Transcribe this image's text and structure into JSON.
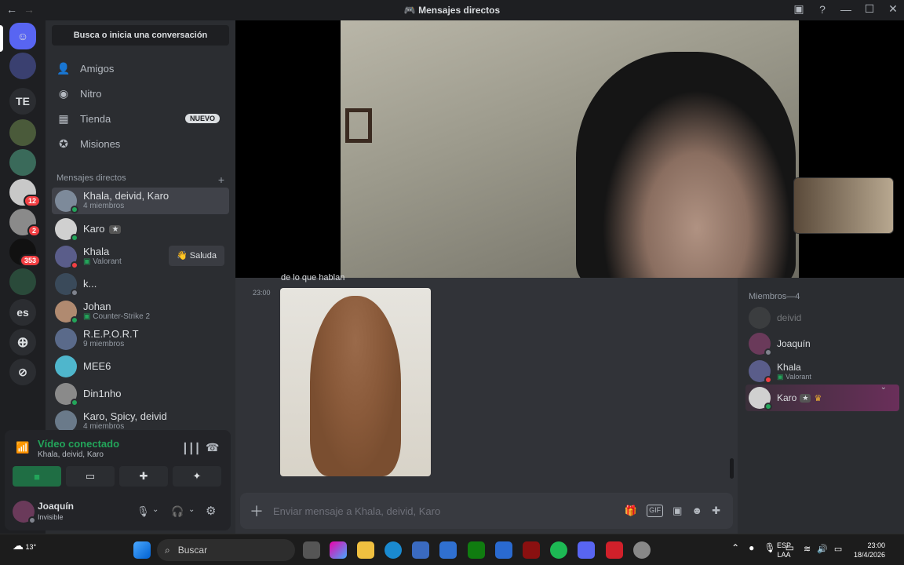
{
  "window": {
    "title": "Mensajes directos"
  },
  "guilds": [
    {
      "label": "TE"
    },
    {
      "label": "es"
    }
  ],
  "guild_badges": [
    "12",
    "2",
    "353"
  ],
  "sidebar": {
    "search_placeholder": "Busca o inicia una conversación",
    "nav": [
      {
        "label": "Amigos",
        "icon": "friends-icon"
      },
      {
        "label": "Nitro",
        "icon": "nitro-icon"
      },
      {
        "label": "Tienda",
        "icon": "shop-icon",
        "badge": "NUEVO"
      },
      {
        "label": "Misiones",
        "icon": "quests-icon"
      }
    ],
    "dm_header": "Mensajes directos",
    "dms": [
      {
        "name": "Khala, deivid, Karo",
        "sub": "4 miembros",
        "color": "#7d8a9a"
      },
      {
        "name": "Karo",
        "sub": "",
        "color": "#d0d0d0"
      },
      {
        "name": "Khala",
        "sub": "Valorant",
        "color": "#5a5d8a",
        "action": "Saluda"
      },
      {
        "name": "k...",
        "sub": "",
        "color": "#3a4a5a"
      },
      {
        "name": "Johan",
        "sub": "Counter-Strike 2",
        "color": "#b08a70"
      },
      {
        "name": "R.E.P.O.R.T",
        "sub": "9 miembros",
        "color": "#5a6a8a"
      },
      {
        "name": "MEE6",
        "sub": "",
        "color": "#4fb6cc"
      },
      {
        "name": "Din1nho",
        "sub": "",
        "color": "#8a8a8a"
      },
      {
        "name": "Karo, Spicy, deivid",
        "sub": "4 miembros",
        "color": "#6a7a8a"
      }
    ]
  },
  "voice": {
    "status": "Vídeo conectado",
    "channel": "Khala, deivid, Karo"
  },
  "user": {
    "name": "Joaquín",
    "status": "Invisible"
  },
  "chat": {
    "cut_text": "de lo que hablan",
    "time": "23:00",
    "placeholder": "Enviar mensaje a Khala, deivid, Karo"
  },
  "members": {
    "header": "Miembros—4",
    "list": [
      {
        "name": "deivid",
        "sub": "",
        "color": "#555"
      },
      {
        "name": "Joaquín",
        "sub": "",
        "color": "#6a3a5a"
      },
      {
        "name": "Khala",
        "sub": "Valorant",
        "color": "#5a5d8a"
      },
      {
        "name": "Karo",
        "sub": "",
        "color": "#d0d0d0"
      }
    ]
  },
  "taskbar": {
    "weather": "13°",
    "search": "Buscar",
    "lang1": "ESP",
    "lang2": "LAA",
    "time": "23:00",
    "date": "18/4/2026"
  }
}
